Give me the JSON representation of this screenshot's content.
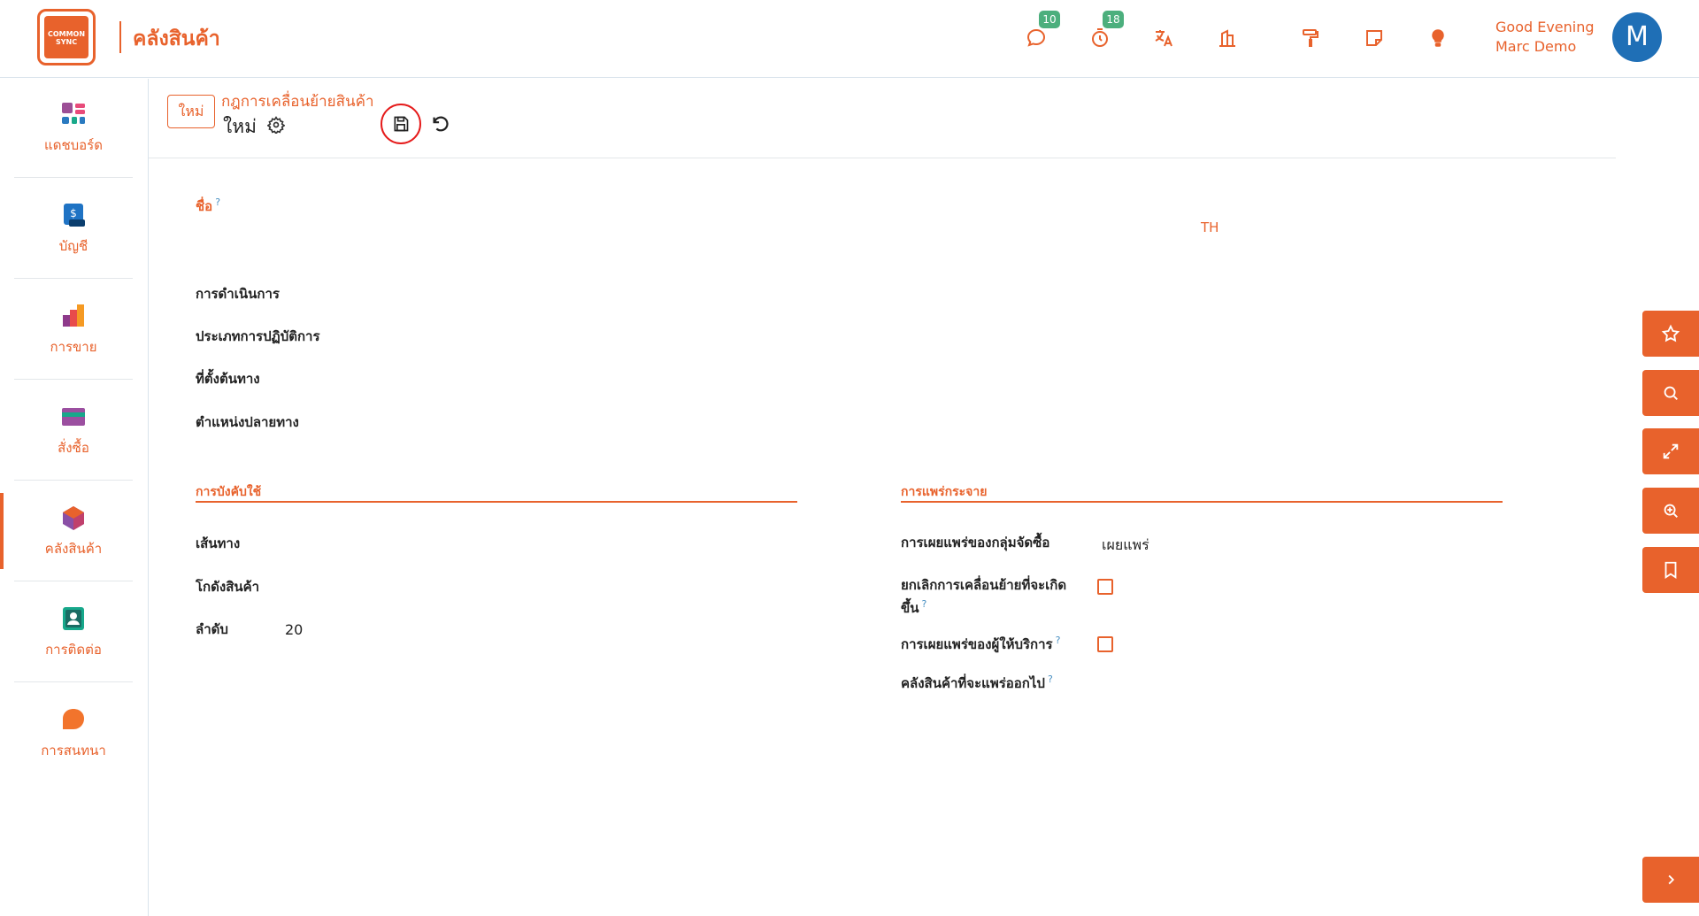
{
  "app": {
    "logo_text": "COMMON SYNC",
    "title": "คลังสินค้า"
  },
  "topbar": {
    "icons": [
      {
        "name": "chat-icon",
        "badge": "10"
      },
      {
        "name": "timer-icon",
        "badge": "18"
      },
      {
        "name": "translate-icon"
      },
      {
        "name": "building-icon"
      },
      {
        "name": "paint-roller-icon"
      },
      {
        "name": "note-icon"
      },
      {
        "name": "lightbulb-icon"
      }
    ],
    "greeting_line1": "Good Evening",
    "greeting_line2": "Marc Demo",
    "avatar_letter": "M"
  },
  "sidebar": {
    "items": [
      {
        "label": "แดชบอร์ด",
        "icon": "dashboard-icon"
      },
      {
        "label": "บัญชี",
        "icon": "accounting-icon"
      },
      {
        "label": "การขาย",
        "icon": "sales-icon"
      },
      {
        "label": "สั่งซื้อ",
        "icon": "purchase-icon"
      },
      {
        "label": "คลังสินค้า",
        "icon": "inventory-icon",
        "active": true
      },
      {
        "label": "การติดต่อ",
        "icon": "contacts-icon"
      },
      {
        "label": "การสนทนา",
        "icon": "discuss-icon"
      }
    ]
  },
  "record": {
    "new_tag": "ใหม่",
    "breadcrumb": "กฎการเคลื่อนย้ายสินค้า",
    "name": "ใหม่"
  },
  "form": {
    "name_label": "ชื่อ",
    "help_mark": "?",
    "lang": "TH",
    "action_label": "การดำเนินการ",
    "operation_type_label": "ประเภทการปฏิบัติการ",
    "source_location_label": "ที่ตั้งต้นทาง",
    "destination_location_label": "ตำแหน่งปลายทาง",
    "applicability_title": "การบังคับใช้",
    "route_label": "เส้นทาง",
    "warehouse_label": "โกดังสินค้า",
    "sequence_label": "ลำดับ",
    "sequence_value": "20",
    "propagation_title": "การแพร่กระจาย",
    "group_propagation_label": "การเผยแพร่ของกลุ่มจัดซื้อ",
    "group_propagation_value": "เผยแพร่",
    "cancel_next_move_label_1": "ยกเลิกการเคลื่อนย้ายที่จะเกิด",
    "cancel_next_move_label_2": "ขึ้น",
    "carrier_propagation_label": "การเผยแพร่ของผู้ให้บริการ",
    "warehouse_to_propagate_label": "คลังสินค้าที่จะแพร่ออกไป"
  },
  "colors": {
    "accent": "#e8622c",
    "badge": "#4caf7d",
    "avatar": "#1f6fb6"
  }
}
